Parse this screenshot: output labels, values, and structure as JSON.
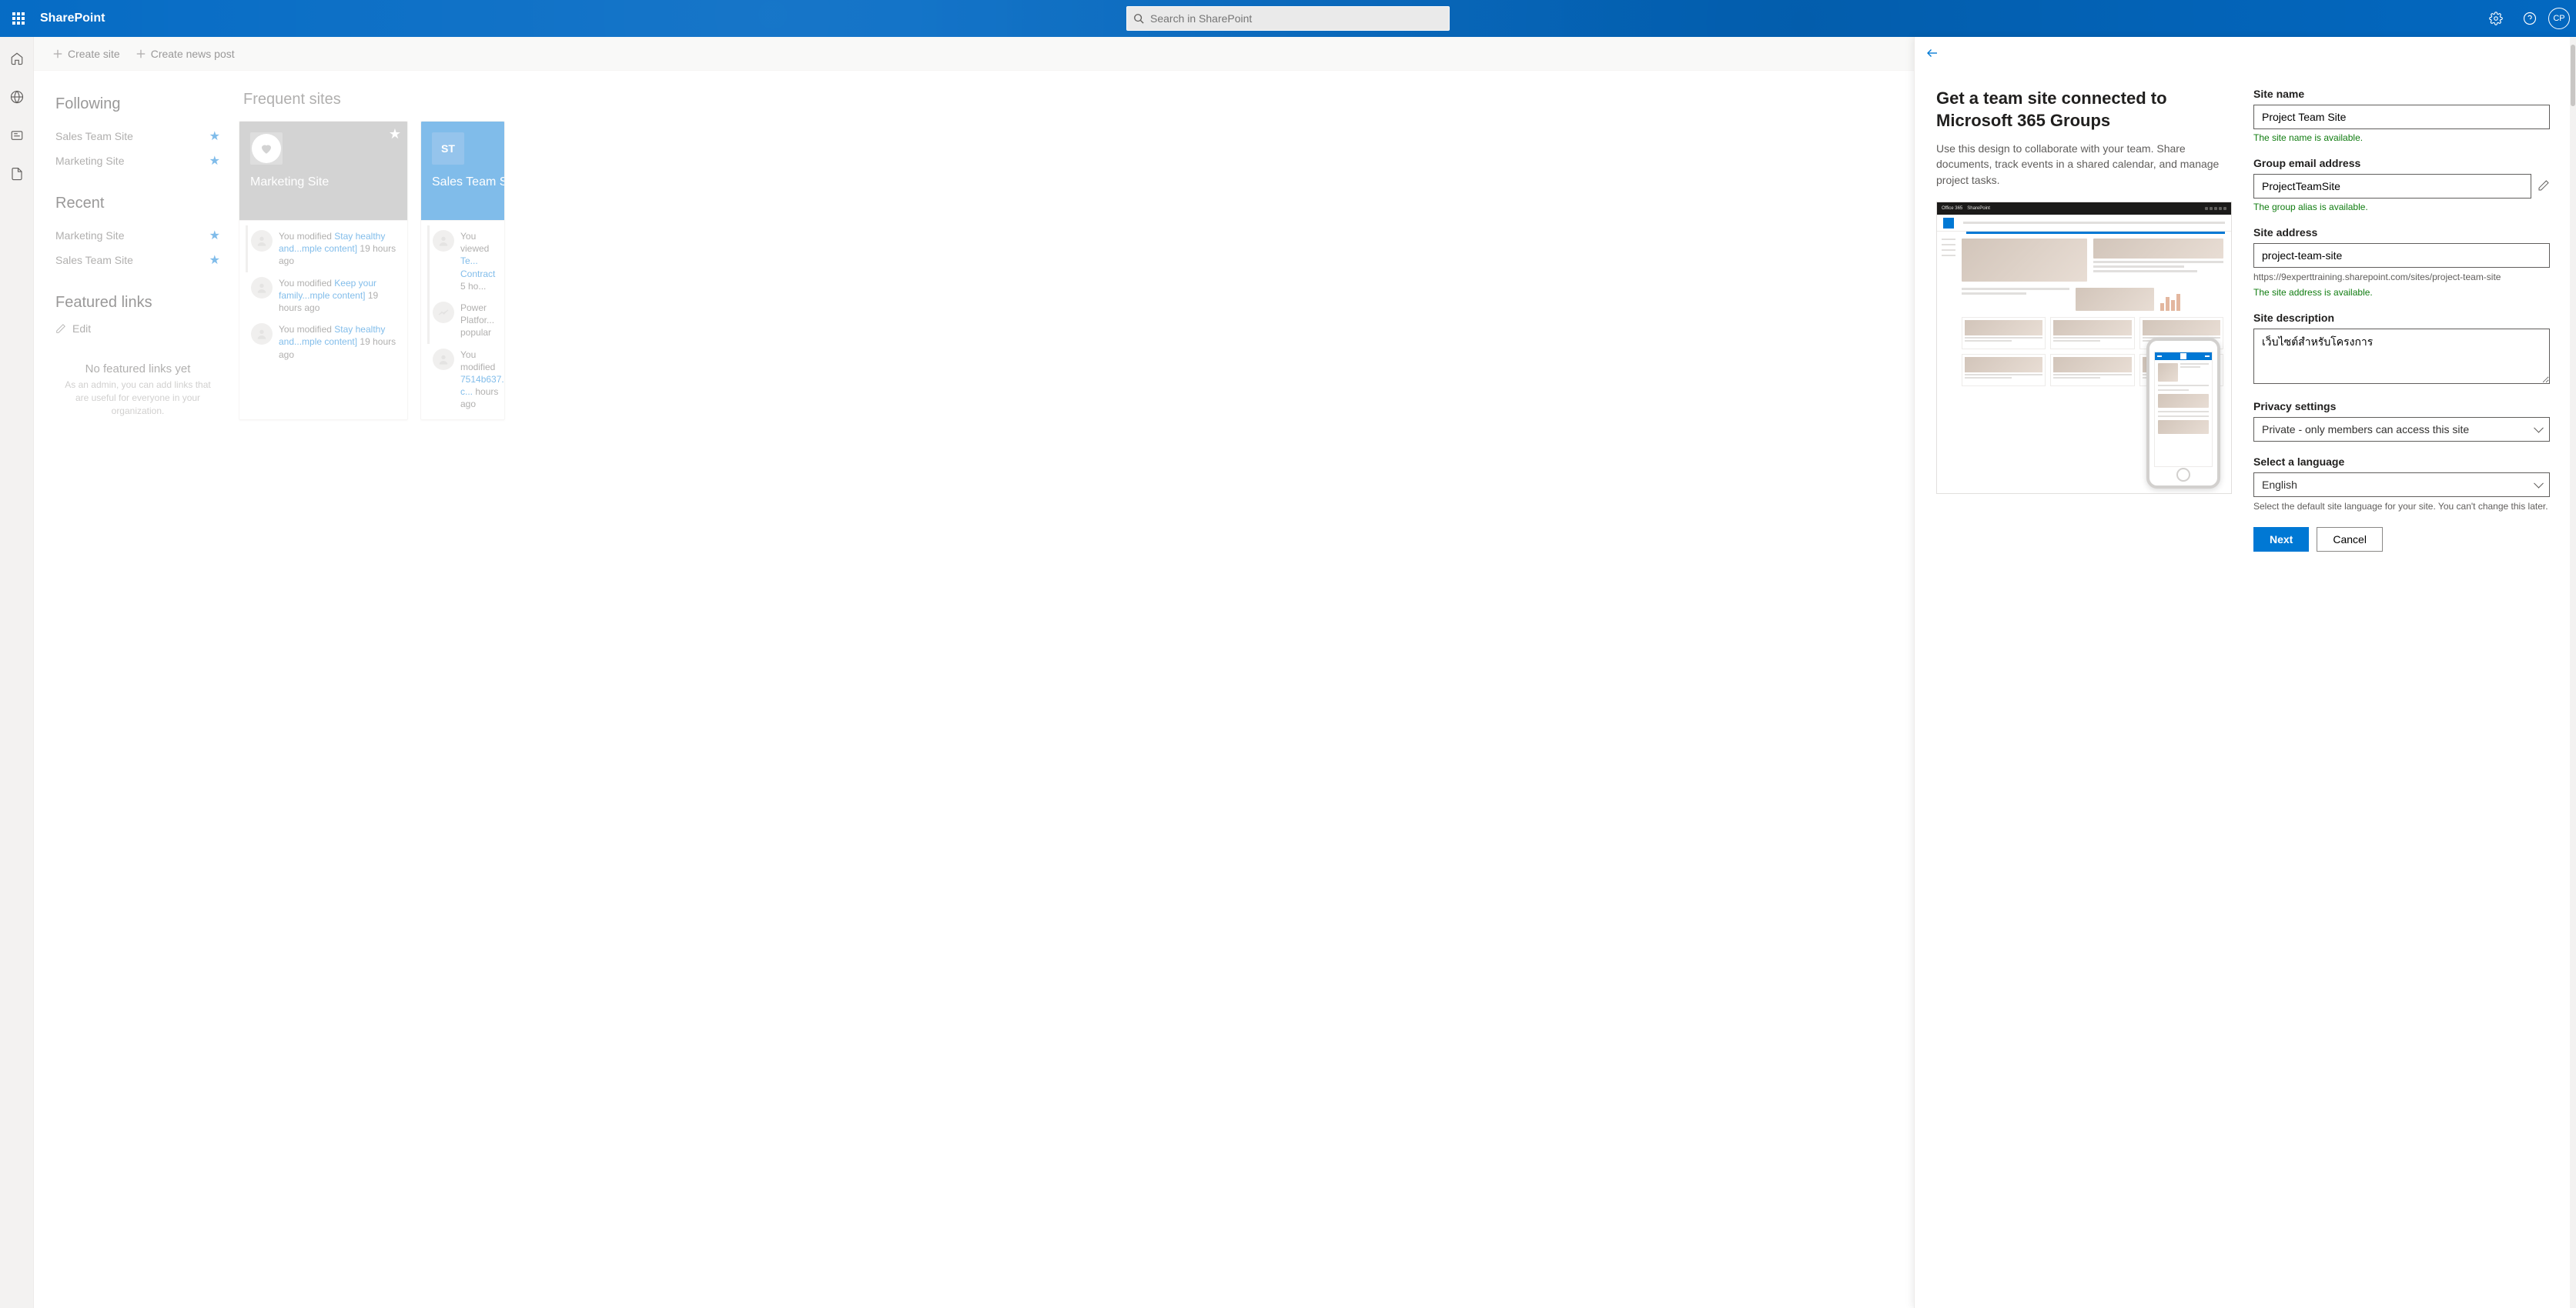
{
  "suite": {
    "app_name": "SharePoint",
    "search_placeholder": "Search in SharePoint",
    "avatar_initials": "CP"
  },
  "commands": {
    "create_site": "Create site",
    "create_news": "Create news post"
  },
  "leftnav": {
    "following_h": "Following",
    "following": [
      {
        "label": "Sales Team Site"
      },
      {
        "label": "Marketing Site"
      }
    ],
    "recent_h": "Recent",
    "recent": [
      {
        "label": "Marketing Site"
      },
      {
        "label": "Sales Team Site"
      }
    ],
    "featured_h": "Featured links",
    "edit_label": "Edit",
    "no_links_title": "No featured links yet",
    "no_links_desc": "As an admin, you can add links that are useful for everyone in your organization."
  },
  "main": {
    "frequent_h": "Frequent sites",
    "cards": [
      {
        "title": "Marketing Site",
        "activities": [
          {
            "prefix": "You modified ",
            "link": "Stay healthy and...mple content]",
            "suffix": " 19 hours ago"
          },
          {
            "prefix": "You modified ",
            "link": "Keep your family...mple content]",
            "suffix": " 19 hours ago"
          },
          {
            "prefix": "You modified ",
            "link": "Stay healthy and...mple content]",
            "suffix": " 19 hours ago"
          }
        ]
      },
      {
        "title": "Sales Team Site",
        "tile_initials": "ST",
        "activities": [
          {
            "prefix": "You viewed ",
            "link": "Te... Contract",
            "suffix": " 5 ho..."
          },
          {
            "text": "Power Platfor... popular"
          },
          {
            "prefix": "You modified ",
            "link": "7514b637...-c...",
            "suffix": " hours ago"
          }
        ]
      }
    ]
  },
  "panel": {
    "title": "Get a team site connected to Microsoft 365 Groups",
    "desc": "Use this design to collaborate with your team. Share documents, track events in a shared calendar, and manage project tasks.",
    "pv_office": "Office 365",
    "pv_sp": "SharePoint",
    "form": {
      "site_name_label": "Site name",
      "site_name_value": "Project Team Site",
      "site_name_ok": "The site name is available.",
      "group_email_label": "Group email address",
      "group_email_value": "ProjectTeamSite",
      "group_email_ok": "The group alias is available.",
      "site_addr_label": "Site address",
      "site_addr_value": "project-team-site",
      "site_addr_url": "https://9experttraining.sharepoint.com/sites/project-team-site",
      "site_addr_ok": "The site address is available.",
      "site_desc_label": "Site description",
      "site_desc_value": "เว็บไซต์สำหรับโครงการ",
      "privacy_label": "Privacy settings",
      "privacy_value": "Private - only members can access this site",
      "lang_label": "Select a language",
      "lang_value": "English",
      "lang_hint": "Select the default site language for your site. You can't change this later.",
      "btn_next": "Next",
      "btn_cancel": "Cancel"
    }
  }
}
